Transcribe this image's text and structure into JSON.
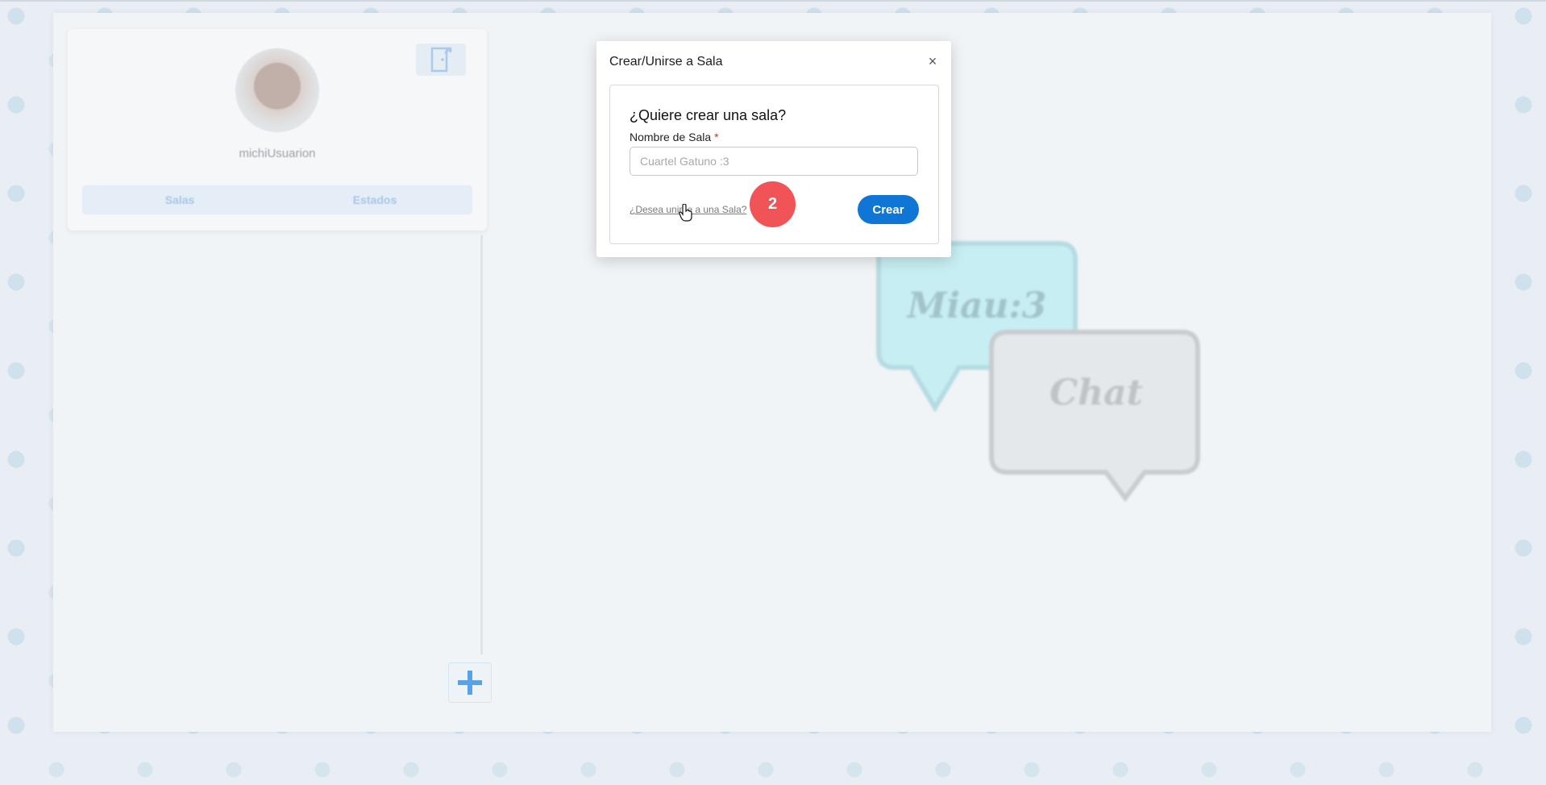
{
  "app": {
    "profile": {
      "username": "michiUsuarion"
    },
    "tabs": [
      {
        "label": "Salas"
      },
      {
        "label": "Estados"
      }
    ],
    "welcome_bubbles": {
      "bubble_1": "Miau:3",
      "bubble_2": "Chat"
    }
  },
  "dialog": {
    "title": "Crear/Unirse a Sala",
    "question": "¿Quiere crear una sala?",
    "room_name_label": "Nombre de Sala",
    "required_marker": "*",
    "room_name_value": "",
    "room_name_placeholder": "Cuartel Gatuno :3",
    "join_link": "¿Desea unirse a una Sala?",
    "create_button": "Crear",
    "close_icon": "×"
  },
  "overlay": {
    "step_badge": "2"
  },
  "colors": {
    "accent": "#0f76d6",
    "badge": "#f05456",
    "bubble_cyan": "#bdeef3",
    "bubble_gray": "#e3e6e9"
  },
  "icons": {
    "exit": "door-exit-icon",
    "add": "plus-icon",
    "close": "close-icon",
    "cursor": "hand-pointer-icon"
  }
}
